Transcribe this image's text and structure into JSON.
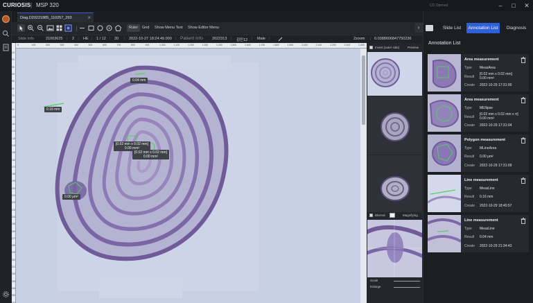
{
  "app": {
    "brand": "CURIOSIS",
    "separator": "|",
    "product": "MSP 320",
    "status_right": "CD Opened"
  },
  "tabs": [
    {
      "label": "Diag.D20221885_110257_293"
    }
  ],
  "toolbar": {
    "ruler_label": "Ruler",
    "grid_label": "Grid",
    "menu_text_label": "Show Menu Text",
    "editor_menu_label": "Show Editor Menu"
  },
  "info": {
    "slide_info_label": "Slide Info",
    "slide_id": "21003625",
    "slide_no": "2",
    "stain": "HE",
    "page": "1 / 12",
    "count": "20",
    "datetime": "2022-10-27 18:24:49.000",
    "patient_info_label": "Patient Info",
    "patient_id": "2022313",
    "patient_name": "김민12",
    "sex": "Male",
    "zoom": "2zoom",
    "pixel_size": "0.0388606847750236"
  },
  "ruler": {
    "top_labels": [
      "0",
      "100",
      "200",
      "300",
      "400",
      "500",
      "600",
      "700",
      "800",
      "900",
      "1,000",
      "1,100",
      "1,200",
      "1,300",
      "1,400",
      "1,500",
      "1,600",
      "1,700",
      "1,800",
      "1,900",
      "2,000",
      "2,100",
      "2,200",
      "2,300",
      "2,400"
    ],
    "left_labels": [
      "10",
      "20",
      "30",
      "40",
      "50",
      "60",
      "70",
      "80",
      "90",
      "100",
      "110",
      "120",
      "130",
      "140",
      "150",
      "160",
      "170",
      "180",
      "190",
      "200",
      "210",
      "220",
      "230",
      "240",
      "250",
      "260",
      "270",
      "280",
      "290",
      "300",
      "310",
      "320",
      "330",
      "340",
      "350",
      "360"
    ]
  },
  "viewer_annotations": [
    {
      "text": "0.16 mm"
    },
    {
      "text": "0.04 mm"
    },
    {
      "line1": "[0.02 mm x 0.02 mm]",
      "line2": "0.00 mm²"
    },
    {
      "line1": "[0.02 mm x 0.02 mm]",
      "line2": "0.00 mm²"
    },
    {
      "text": "0.00 μm²"
    }
  ],
  "preview": {
    "invert_label": "Invert (outer side)",
    "preview_label": "Preview",
    "blurred_label": "Blurred",
    "magnifying_label": "Magnifying",
    "scale_label": "Scale",
    "enlarge_label": "Enlarge"
  },
  "right_panel": {
    "tabs": [
      "Slide List",
      "Annotation List",
      "Diagnosis"
    ],
    "active_tab": "Annotation List",
    "title": "Annotation List",
    "labels": {
      "type": "Type",
      "result": "Result",
      "create": "Create"
    },
    "annotations": [
      {
        "name": "Area measurement",
        "type": "MeasArea",
        "result_1": "[0.02 mm x 0.02 mm]",
        "result_2": "0.00 mm²",
        "create": "2022-10-29 17:31:00"
      },
      {
        "name": "Area measurement",
        "type": "MEllipse",
        "result_1": "[0.02 mm x 0.02 mm x π]",
        "result_2": "0.00 mm²",
        "create": "2022-10-29 17:31:04"
      },
      {
        "name": "Polygon measurement",
        "type": "MLineArea",
        "result_1": "0.00 μm²",
        "result_2": "",
        "create": "2022-10-29 17:31:09"
      },
      {
        "name": "Line measurement",
        "type": "MeasLine",
        "result_1": "0.16 mm",
        "result_2": "",
        "create": "2022-10-29 18:45:57"
      },
      {
        "name": "Line measurement",
        "type": "MeasLine",
        "result_1": "0.04 mm",
        "result_2": "",
        "create": "2022-10-29 21:34:43"
      }
    ]
  },
  "colors": {
    "accent": "#2f5fd9",
    "tissue_outer": "#6a4f8f",
    "tissue_inner": "#8a76b6",
    "measure": "#4fd15a"
  }
}
